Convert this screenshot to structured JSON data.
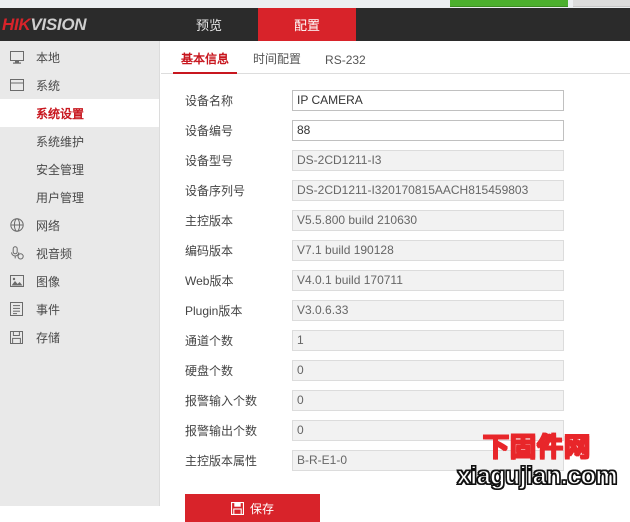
{
  "window": {
    "chrome_sliver": {
      "green_bar": "green-progress-fragment",
      "gray_bar": "gray-button-fragment"
    }
  },
  "topnav": {
    "logo": {
      "part1": "HIK",
      "part2": "VISION"
    },
    "tabs": [
      {
        "label": "预览",
        "name": "nav-tab-preview",
        "active": false
      },
      {
        "label": "配置",
        "name": "nav-tab-configuration",
        "active": true
      }
    ],
    "colors": {
      "bg": "#2b2b2b",
      "active": "#d8232a",
      "logo_red": "#d8232a"
    }
  },
  "sidebar": {
    "items": [
      {
        "label": "本地",
        "icon": "monitor-icon",
        "type": "group"
      },
      {
        "label": "系统",
        "icon": "system-window-icon",
        "type": "group"
      },
      {
        "label": "系统设置",
        "type": "sub",
        "active": true
      },
      {
        "label": "系统维护",
        "type": "sub",
        "active": false
      },
      {
        "label": "安全管理",
        "type": "sub",
        "active": false
      },
      {
        "label": "用户管理",
        "type": "sub",
        "active": false
      },
      {
        "label": "网络",
        "icon": "globe-icon",
        "type": "group"
      },
      {
        "label": "视音频",
        "icon": "audio-video-icon",
        "type": "group"
      },
      {
        "label": "图像",
        "icon": "image-icon",
        "type": "group"
      },
      {
        "label": "事件",
        "icon": "event-list-icon",
        "type": "group"
      },
      {
        "label": "存储",
        "icon": "storage-disk-icon",
        "type": "group"
      }
    ],
    "colors": {
      "bg": "#e9e9e9",
      "active_text": "#c8171f"
    }
  },
  "content": {
    "tabs": [
      {
        "label": "基本信息",
        "name": "tab-basic-info",
        "active": true
      },
      {
        "label": "时间配置",
        "name": "tab-time-settings",
        "active": false
      },
      {
        "label": "RS-232",
        "name": "tab-rs232",
        "active": false
      }
    ],
    "fields": [
      {
        "label": "设备名称",
        "value": "IP CAMERA",
        "readonly": false,
        "name": "device-name"
      },
      {
        "label": "设备编号",
        "value": "88",
        "readonly": false,
        "name": "device-number"
      },
      {
        "label": "设备型号",
        "value": "DS-2CD1211-I3",
        "readonly": true,
        "name": "device-model"
      },
      {
        "label": "设备序列号",
        "value": "DS-2CD1211-I320170815AACH815459803",
        "readonly": true,
        "name": "device-serial-number"
      },
      {
        "label": "主控版本",
        "value": "V5.5.800 build 210630",
        "readonly": true,
        "name": "firmware-version"
      },
      {
        "label": "编码版本",
        "value": "V7.1 build 190128",
        "readonly": true,
        "name": "encoding-version"
      },
      {
        "label": "Web版本",
        "value": "V4.0.1 build 170711",
        "readonly": true,
        "name": "web-version"
      },
      {
        "label": "Plugin版本",
        "value": "V3.0.6.33",
        "readonly": true,
        "name": "plugin-version"
      },
      {
        "label": "通道个数",
        "value": "1",
        "readonly": true,
        "name": "channel-count"
      },
      {
        "label": "硬盘个数",
        "value": "0",
        "readonly": true,
        "name": "hdd-count"
      },
      {
        "label": "报警输入个数",
        "value": "0",
        "readonly": true,
        "name": "alarm-input-count"
      },
      {
        "label": "报警输出个数",
        "value": "0",
        "readonly": true,
        "name": "alarm-output-count"
      },
      {
        "label": "主控版本属性",
        "value": "B-R-E1-0",
        "readonly": true,
        "name": "firmware-version-property"
      }
    ],
    "save_button": {
      "label": "保存",
      "icon": "save-floppy-icon",
      "color": "#d8232a"
    }
  },
  "watermark": {
    "line1": "下固件网",
    "line2": "xiagujian.com",
    "colors": {
      "cn_fill": "#ffe400",
      "cn_stroke": "#e8262a",
      "en_fill": "#ffffff",
      "en_stroke": "#111111"
    }
  }
}
